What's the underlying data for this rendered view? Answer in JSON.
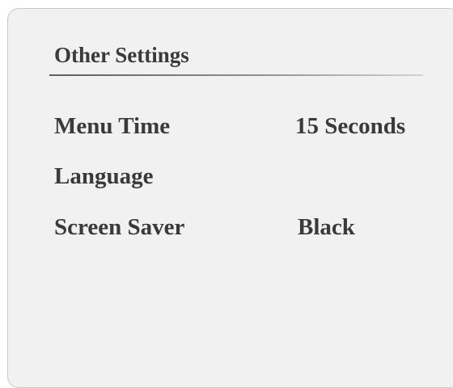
{
  "panel": {
    "title": "Other Settings"
  },
  "settings": [
    {
      "label": "Menu Time",
      "value": "15 Seconds"
    },
    {
      "label": "Language",
      "value": ""
    },
    {
      "label": "Screen Saver",
      "value": "Black"
    }
  ],
  "colors": {
    "panel_background": "#f1f1f1",
    "panel_border": "#c9c9c9",
    "text": "#3a3a3a"
  }
}
